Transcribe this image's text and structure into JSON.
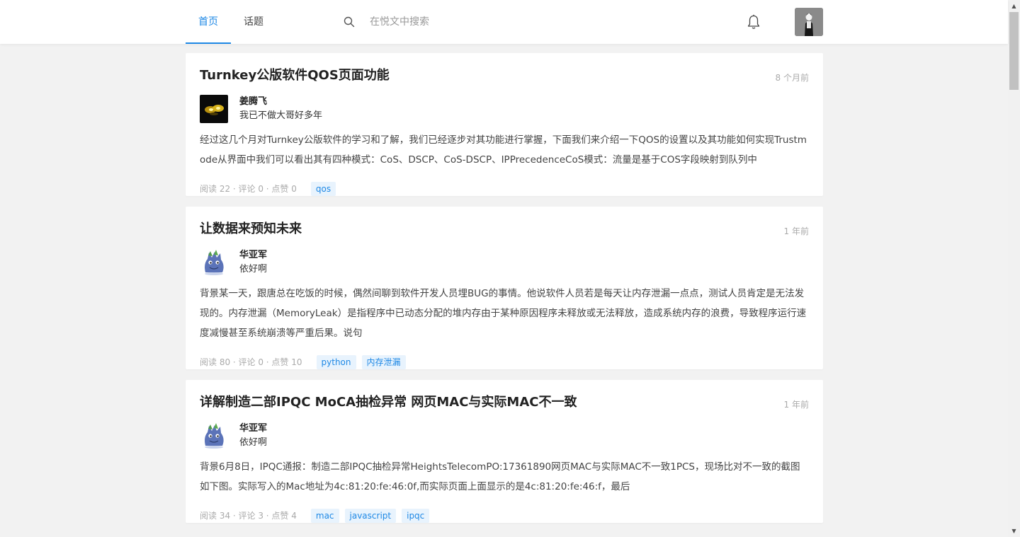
{
  "nav": {
    "tabs": [
      {
        "label": "首页",
        "active": true
      },
      {
        "label": "话题",
        "active": false
      }
    ],
    "search_placeholder": "在悦文中搜索",
    "accent_color": "#1e88e5"
  },
  "feed": [
    {
      "title": "Turnkey公版软件QOS页面功能",
      "time": "8 个月前",
      "author": {
        "name": "姜腾飞",
        "motto": "我已不做大哥好多年",
        "avatar_icon": "yellow-eyes-avatar"
      },
      "excerpt": "经过这几个月对Turnkey公版软件的学习和了解，我们已经逐步对其功能进行掌握，下面我们来介绍一下QOS的设置以及其功能如何实现Trustmode从界面中我们可以看出其有四种模式：CoS、DSCP、CoS-DSCP、IPPrecedenceCoS模式：流量是基于COS字段映射到队列中",
      "stats": "阅读 22 · 评论 0 · 点赞 0",
      "tags": [
        "qos"
      ]
    },
    {
      "title": "让数据来预知未来",
      "time": "1 年前",
      "author": {
        "name": "华亚军",
        "motto": "依好啊",
        "avatar_icon": "blue-monster-avatar"
      },
      "excerpt": "背景某一天，跟唐总在吃饭的时候，偶然间聊到软件开发人员埋BUG的事情。他说软件人员若是每天让内存泄漏一点点，测试人员肯定是无法发现的。内存泄漏（MemoryLeak）是指程序中已动态分配的堆内存由于某种原因程序未释放或无法释放，造成系统内存的浪费，导致程序运行速度减慢甚至系统崩溃等严重后果。说句",
      "stats": "阅读 80 · 评论 0 · 点赞 10",
      "tags": [
        "python",
        "内存泄漏"
      ]
    },
    {
      "title": "详解制造二部IPQC MoCA抽检异常 网页MAC与实际MAC不一致",
      "time": "1 年前",
      "author": {
        "name": "华亚军",
        "motto": "依好啊",
        "avatar_icon": "blue-monster-avatar"
      },
      "excerpt": "背景6月8日，IPQC通报：制造二部IPQC抽检异常HeightsTelecomPO:17361890网页MAC与实际MAC不一致1PCS，现场比对不一致的截图如下图。实际写入的Mac地址为4c:81:20:fe:46:0f,而实际页面上面显示的是4c:81:20:fe:46:f，最后",
      "stats": "阅读 34 · 评论 3 · 点赞 4",
      "tags": [
        "mac",
        "javascript",
        "ipqc"
      ]
    }
  ]
}
